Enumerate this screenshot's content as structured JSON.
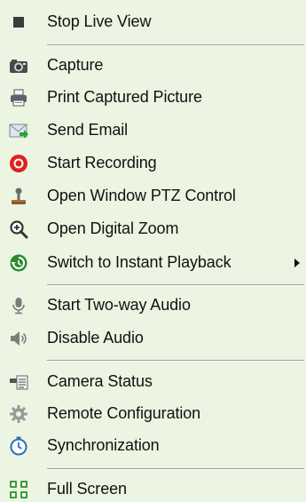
{
  "menu": {
    "items": [
      {
        "id": "stop-live-view",
        "label": "Stop Live View"
      },
      {
        "id": "capture",
        "label": "Capture"
      },
      {
        "id": "print-captured-picture",
        "label": "Print Captured Picture"
      },
      {
        "id": "send-email",
        "label": "Send Email"
      },
      {
        "id": "start-recording",
        "label": "Start Recording"
      },
      {
        "id": "open-window-ptz-control",
        "label": "Open Window PTZ Control"
      },
      {
        "id": "open-digital-zoom",
        "label": "Open Digital Zoom"
      },
      {
        "id": "switch-to-instant-playback",
        "label": "Switch to Instant Playback",
        "has_submenu": true
      },
      {
        "id": "start-two-way-audio",
        "label": "Start Two-way Audio"
      },
      {
        "id": "disable-audio",
        "label": "Disable Audio"
      },
      {
        "id": "camera-status",
        "label": "Camera Status"
      },
      {
        "id": "remote-configuration",
        "label": "Remote Configuration"
      },
      {
        "id": "synchronization",
        "label": "Synchronization"
      },
      {
        "id": "full-screen",
        "label": "Full Screen"
      }
    ]
  },
  "icons": {
    "stop-live-view": "stop-square-icon",
    "capture": "camera-icon",
    "print-captured-picture": "printer-icon",
    "send-email": "envelope-icon",
    "start-recording": "record-icon",
    "open-window-ptz-control": "joystick-icon",
    "open-digital-zoom": "magnifier-icon",
    "switch-to-instant-playback": "playback-icon",
    "start-two-way-audio": "microphone-icon",
    "disable-audio": "speaker-icon",
    "camera-status": "camera-status-icon",
    "remote-configuration": "gear-icon",
    "synchronization": "clock-icon",
    "full-screen": "fullscreen-icon"
  },
  "colors": {
    "menu_background": "#ecf5e1",
    "separator": "#9aa39a",
    "record_red": "#e02020",
    "playback_green": "#2f8a2f"
  }
}
